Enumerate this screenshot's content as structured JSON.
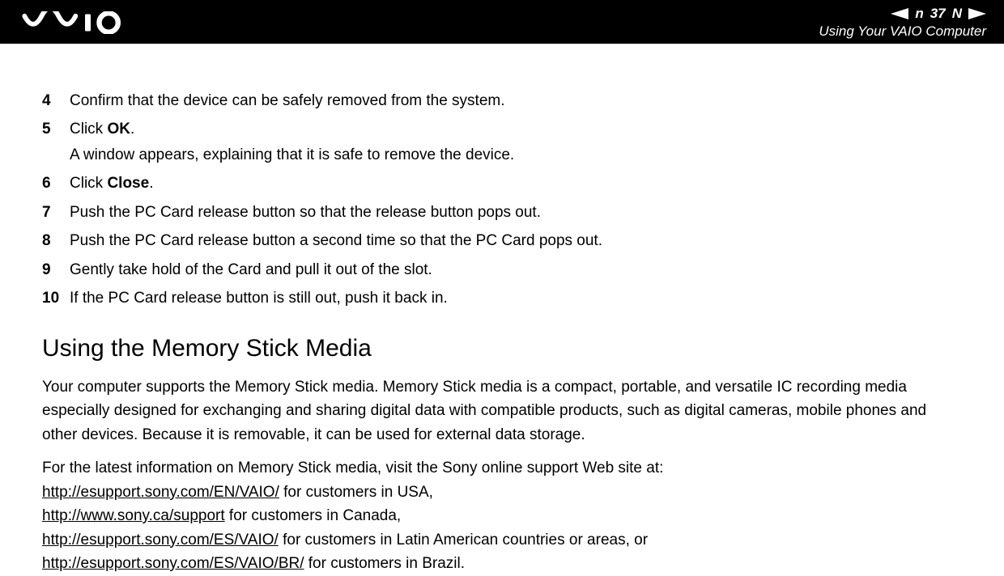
{
  "header": {
    "page_number": "37",
    "section_title": "Using Your VAIO Computer"
  },
  "steps": [
    {
      "num": "4",
      "text": "Confirm that the device can be safely removed from the system."
    },
    {
      "num": "5",
      "prefix": "Click ",
      "bold": "OK",
      "suffix": ".",
      "sub": "A window appears, explaining that it is safe to remove the device."
    },
    {
      "num": "6",
      "prefix": "Click ",
      "bold": "Close",
      "suffix": "."
    },
    {
      "num": "7",
      "text": "Push the PC Card release button so that the release button pops out."
    },
    {
      "num": "8",
      "text": "Push the PC Card release button a second time so that the PC Card pops out."
    },
    {
      "num": "9",
      "text": "Gently take hold of the Card and pull it out of the slot."
    },
    {
      "num": "10",
      "text": "If the PC Card release button is still out, push it back in."
    }
  ],
  "section": {
    "heading": "Using the Memory Stick Media",
    "paragraph": "Your computer supports the Memory Stick media. Memory Stick media is a compact, portable, and versatile IC recording media especially designed for exchanging and sharing digital data with compatible products, such as digital cameras, mobile phones and other devices. Because it is removable, it can be used for external data storage.",
    "intro": "For the latest information on Memory Stick media, visit the Sony online support Web site at:",
    "links": [
      {
        "url": "http://esupport.sony.com/EN/VAIO/",
        "suffix": " for customers in USA,"
      },
      {
        "url": "http://www.sony.ca/support",
        "suffix": " for customers in Canada,"
      },
      {
        "url": "http://esupport.sony.com/ES/VAIO/",
        "suffix": " for customers in Latin American countries or areas, or"
      },
      {
        "url": "http://esupport.sony.com/ES/VAIO/BR/",
        "suffix": " for customers in Brazil."
      }
    ]
  }
}
